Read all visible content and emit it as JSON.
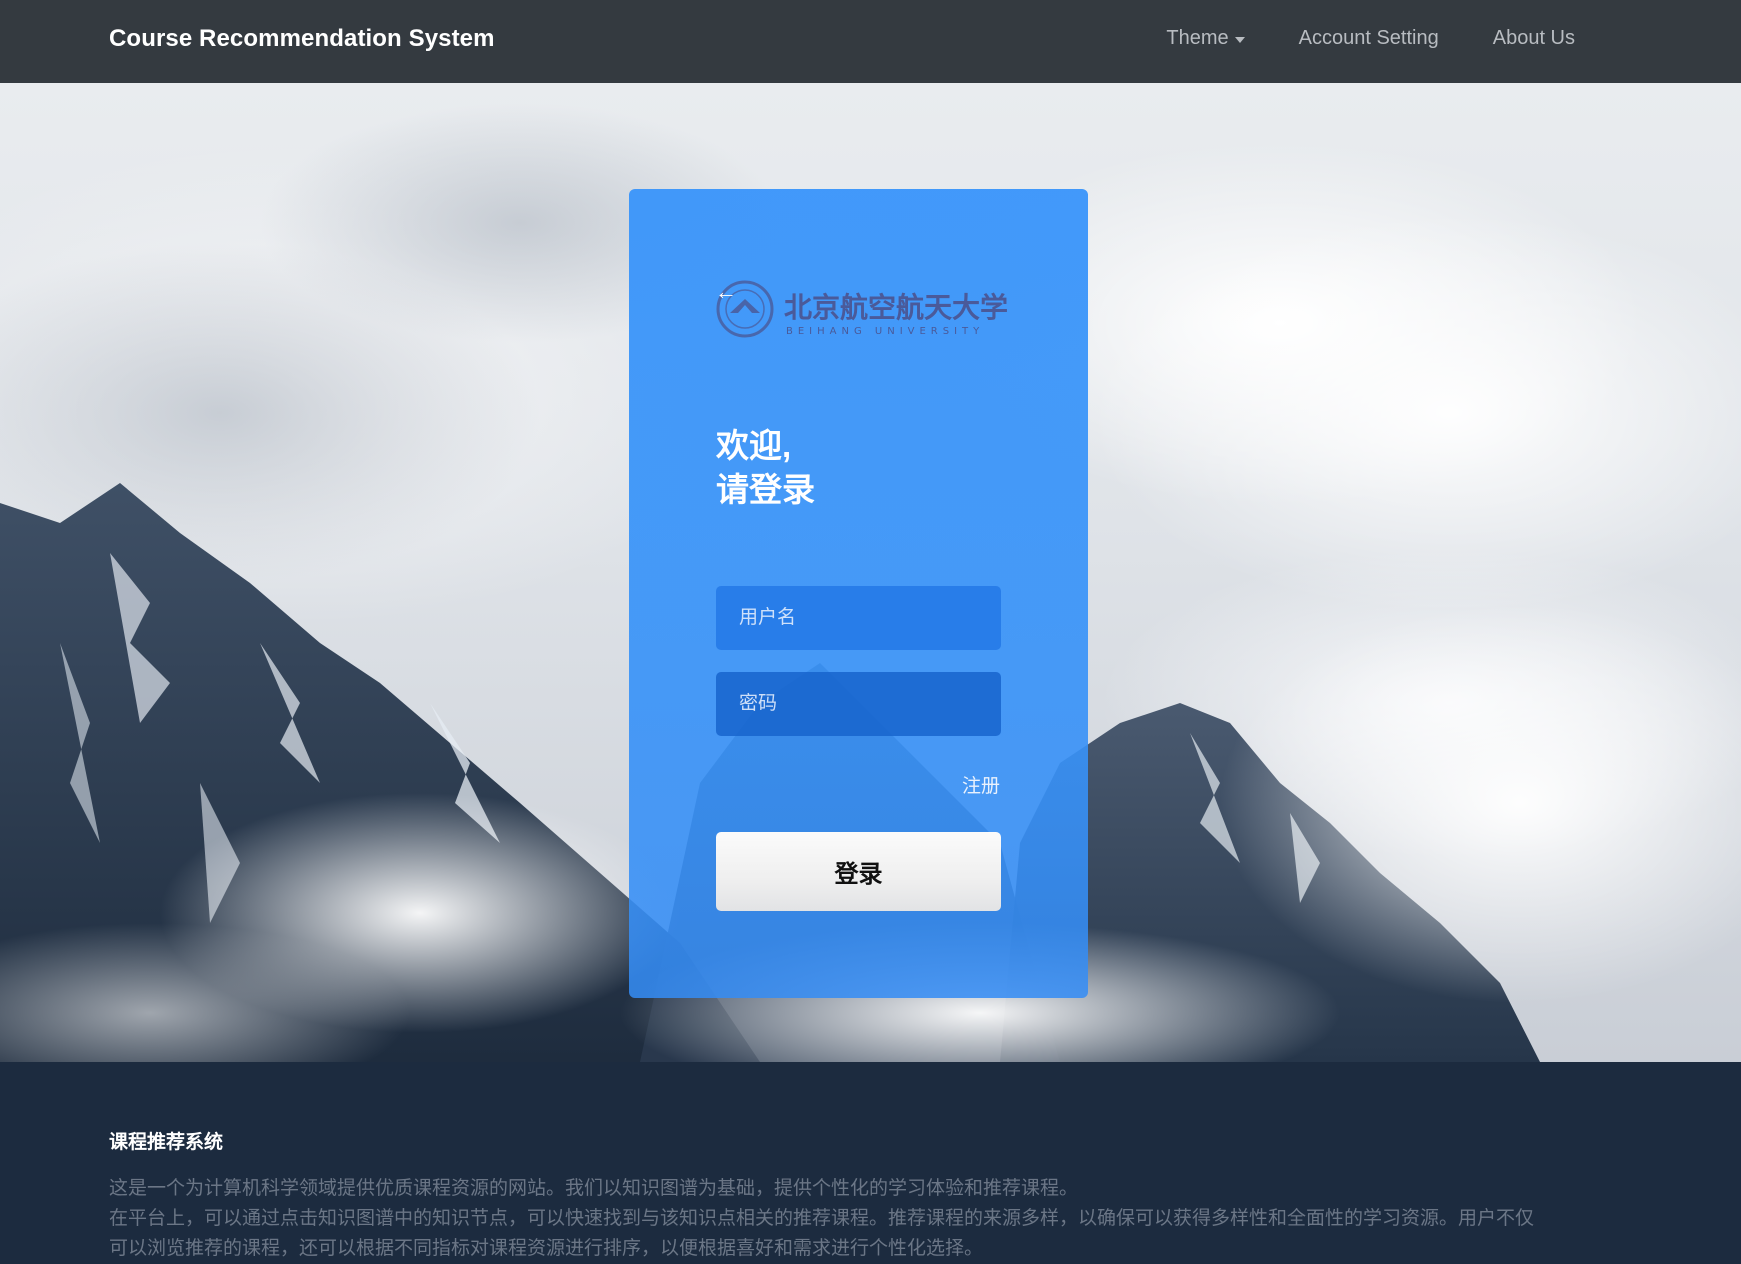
{
  "navbar": {
    "brand": "Course Recommendation System",
    "items": [
      {
        "label": "Theme",
        "has_dropdown": true
      },
      {
        "label": "Account Setting"
      },
      {
        "label": "About Us"
      }
    ]
  },
  "login": {
    "logo_text_cn": "北京航空航天大学",
    "logo_text_en": "BEIHANG UNIVERSITY",
    "welcome_line1": "欢迎,",
    "welcome_line2": "请登录",
    "username_placeholder": "用户名",
    "password_placeholder": "密码",
    "register_label": "注册",
    "login_button": "登录"
  },
  "footer": {
    "title": "课程推荐系统",
    "lines": [
      "这是一个为计算机科学领域提供优质课程资源的网站。我们以知识图谱为基础，提供个性化的学习体验和推荐课程。",
      "在平台上，可以通过点击知识图谱中的知识节点，可以快速找到与该知识点相关的推荐课程。推荐课程的来源多样，以确保可以获得多样性和全面性的学习资源。用户不仅",
      "可以浏览推荐的课程，还可以根据不同指标对课程资源进行排序，以便根据喜好和需求进行个性化选择。"
    ]
  },
  "colors": {
    "navbar_bg": "#343a40",
    "card_accent": "#3c96fa",
    "footer_bg": "#1c2b3f"
  }
}
